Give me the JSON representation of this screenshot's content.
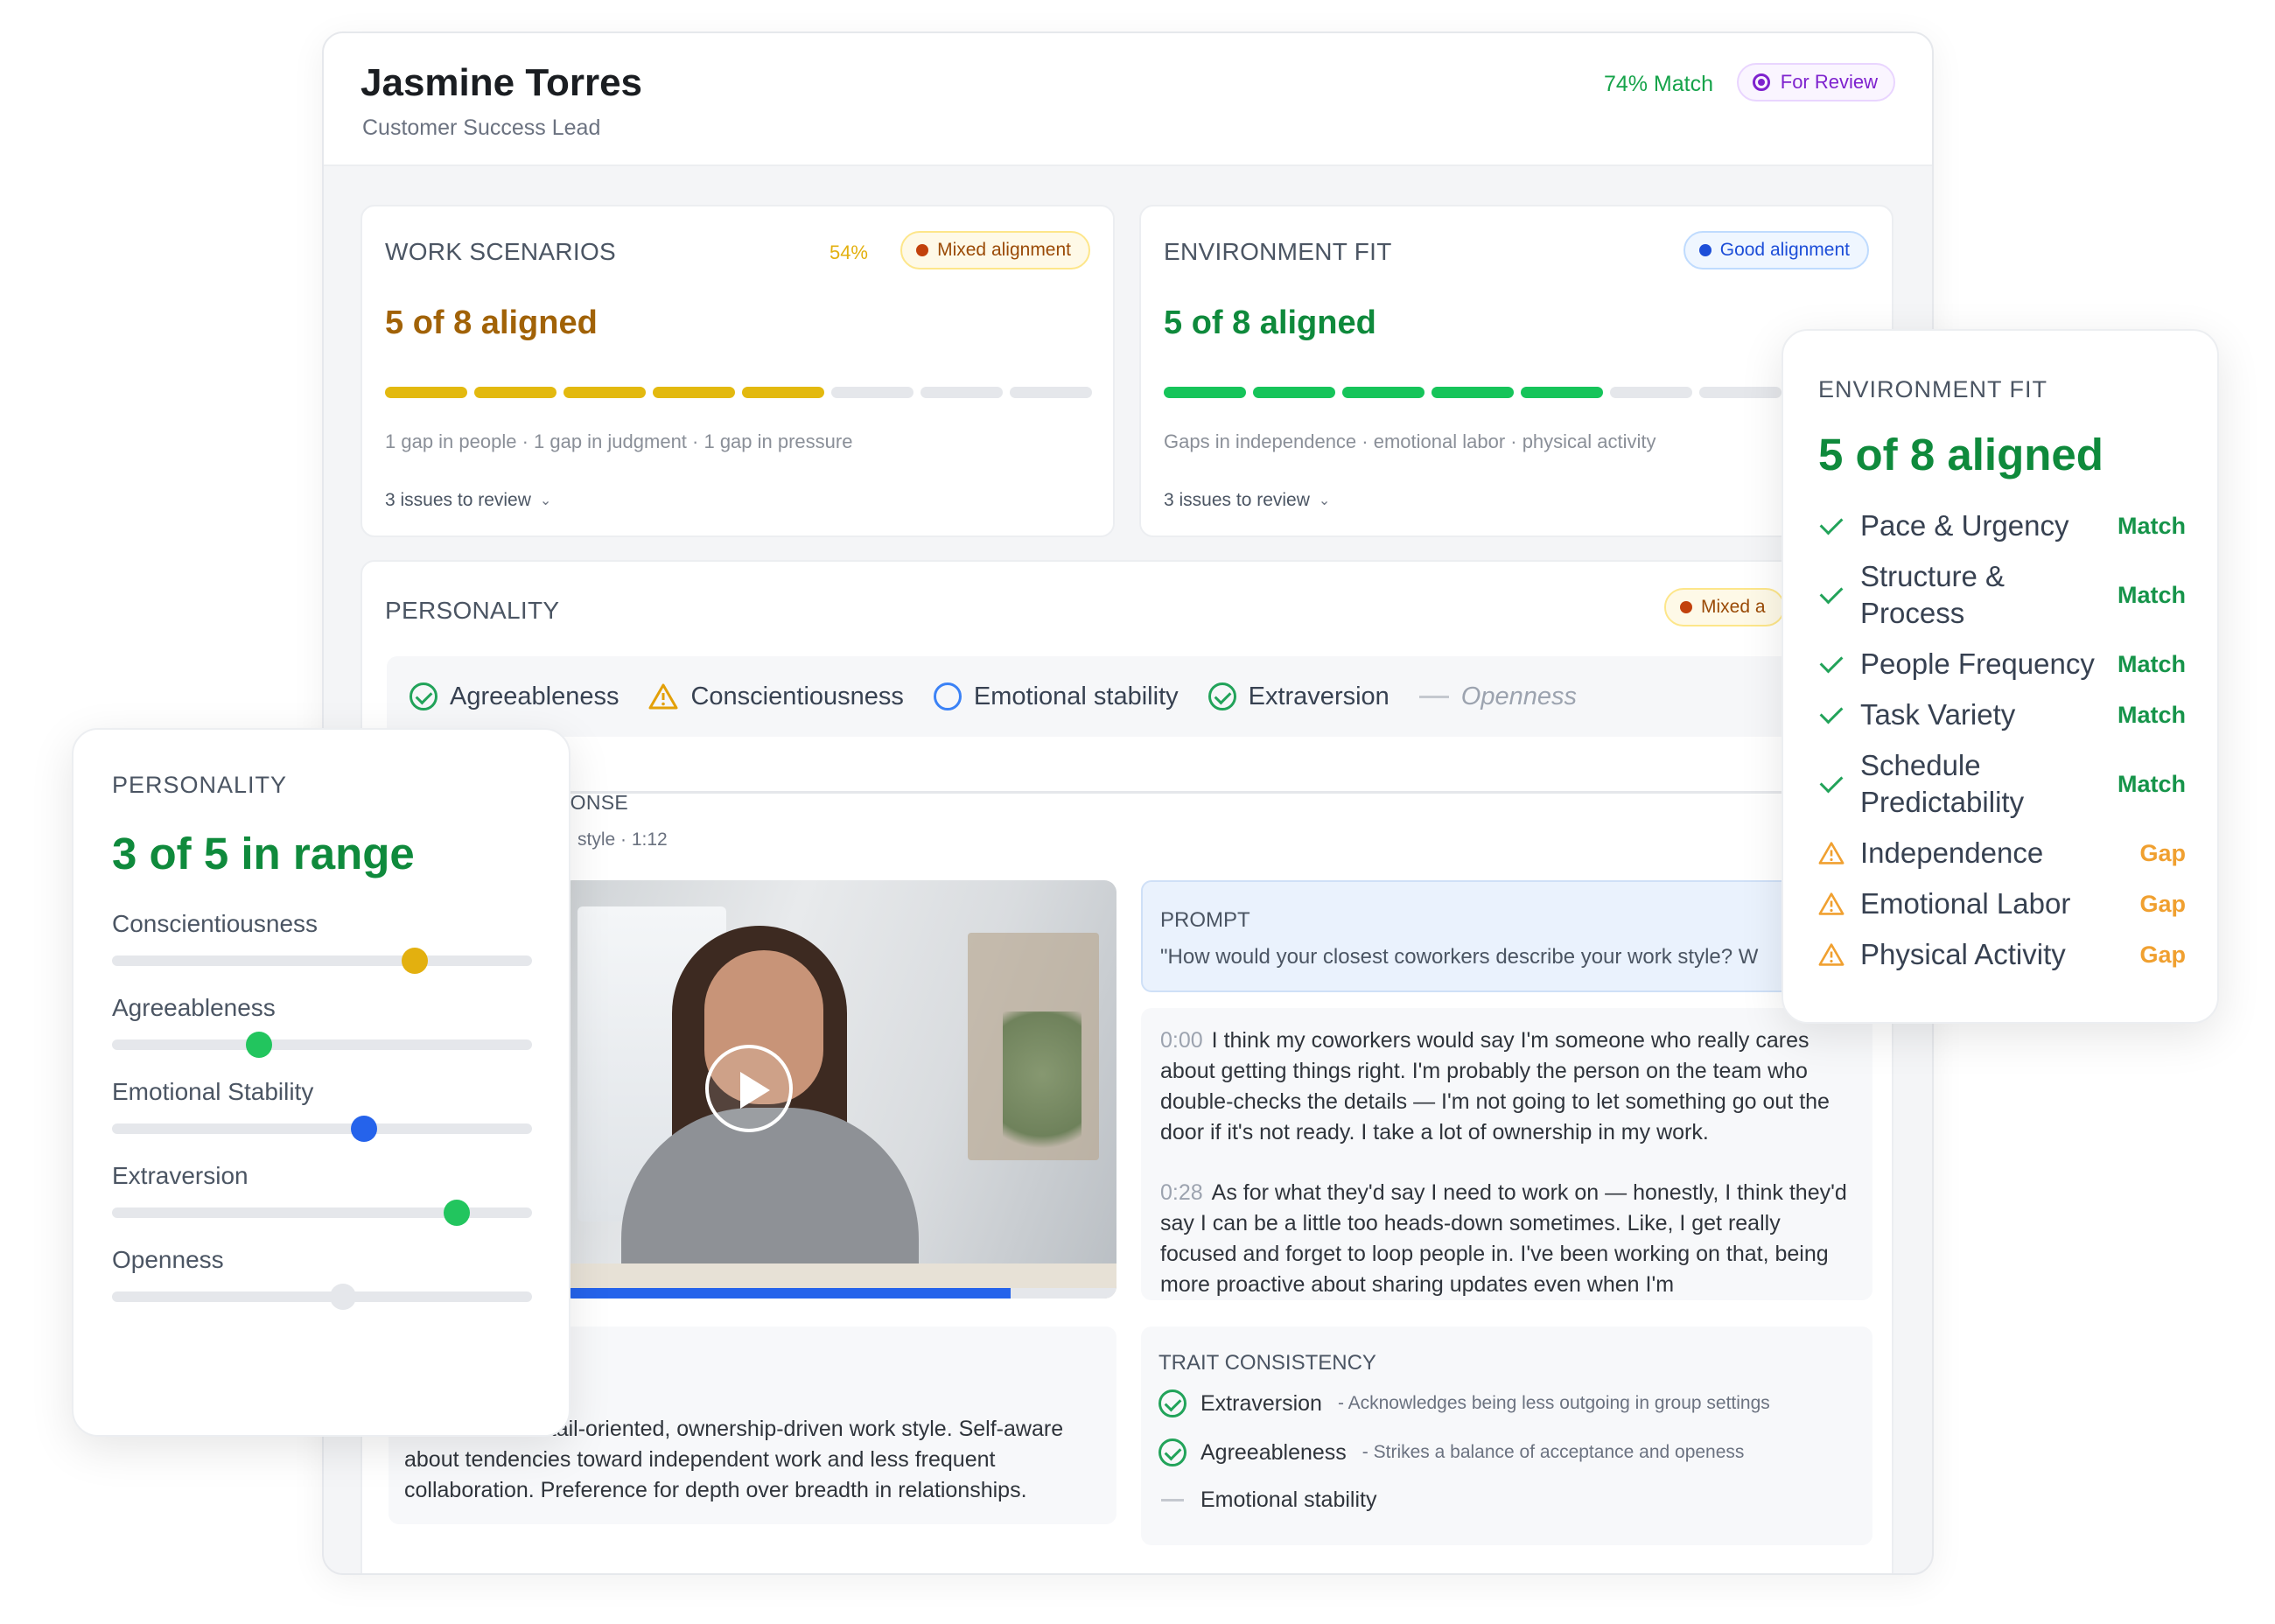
{
  "candidate": {
    "name": "Jasmine Torres",
    "role": "Customer Success Lead",
    "match": "74% Match",
    "status": "For Review"
  },
  "work_scenarios": {
    "title": "WORK SCENARIOS",
    "percent": "54%",
    "badge": "Mixed alignment",
    "count": "5 of 8 aligned",
    "aligned": 5,
    "total": 8,
    "gaps": "1 gap in people · 1 gap in judgment · 1 gap in pressure",
    "issues": "3 issues to review"
  },
  "environment_fit": {
    "title": "ENVIRONMENT FIT",
    "badge": "Good alignment",
    "count": "5 of 8 aligned",
    "aligned": 5,
    "total": 8,
    "gaps": "Gaps in independence · emotional labor · physical activity",
    "issues": "3 issues to review"
  },
  "personality": {
    "title": "PERSONALITY",
    "badge": "Mixed a",
    "traits": [
      {
        "label": "Agreeableness",
        "icon": "check-circle-icon"
      },
      {
        "label": "Conscientiousness",
        "icon": "warning-icon"
      },
      {
        "label": "Emotional stability",
        "icon": "ring-icon"
      },
      {
        "label": "Extraversion",
        "icon": "check-circle-icon"
      },
      {
        "label": "Openness",
        "icon": "dash-icon"
      }
    ]
  },
  "response": {
    "label": "PONSE",
    "meta": "style · 1:12",
    "video_progress": 0.81,
    "prompt_title": "PROMPT",
    "prompt_text": "\"How would your closest coworkers describe your work style? W",
    "transcript": [
      {
        "time": "0:00",
        "text": "I think my coworkers would say I'm someone who really cares about getting things right. I'm probably the person on the team who double-checks the details — I'm not going to let something go out the door if it's not ready. I take a lot of ownership in my work."
      },
      {
        "time": "0:28",
        "text": "As for what they'd say I need to work on — honestly, I think they'd say I can be a little too heads-down sometimes. Like, I get really focused and forget to loop people in. I've been working on that, being more proactive about sharing updates even when I'm"
      }
    ],
    "summary": "Describes a detail-oriented, ownership-driven work style. Self-aware about tendencies toward independent work and less frequent collaboration. Preference for depth over breadth in relationships."
  },
  "trait_consistency": {
    "title": "TRAIT CONSISTENCY",
    "rows": [
      {
        "name": "Extraversion",
        "note": "- Acknowledges being less outgoing in group settings",
        "icon": "check-circle-icon"
      },
      {
        "name": "Agreeableness",
        "note": "- Strikes a balance of acceptance and openess",
        "icon": "check-circle-icon"
      },
      {
        "name": "Emotional stability",
        "note": "",
        "icon": "dash-icon"
      }
    ]
  },
  "personality_card": {
    "title": "PERSONALITY",
    "count": "3 of 5 in range",
    "sliders": [
      {
        "label": "Conscientiousness",
        "value": 0.72,
        "color": "#e3b00f"
      },
      {
        "label": "Agreeableness",
        "value": 0.35,
        "color": "#22c55e"
      },
      {
        "label": "Emotional Stability",
        "value": 0.6,
        "color": "#2563eb"
      },
      {
        "label": "Extraversion",
        "value": 0.82,
        "color": "#22c55e"
      },
      {
        "label": "Openness",
        "value": 0.55,
        "color": "#e5e7eb"
      }
    ]
  },
  "environment_card": {
    "title": "ENVIRONMENT FIT",
    "count": "5 of 8 aligned",
    "rows": [
      {
        "label": "Pace & Urgency",
        "status": "Match"
      },
      {
        "label": "Structure & Process",
        "status": "Match"
      },
      {
        "label": "People Frequency",
        "status": "Match"
      },
      {
        "label": "Task Variety",
        "status": "Match"
      },
      {
        "label": "Schedule Predictability",
        "status": "Match"
      },
      {
        "label": "Independence",
        "status": "Gap"
      },
      {
        "label": "Emotional Labor",
        "status": "Gap"
      },
      {
        "label": "Physical Activity",
        "status": "Gap"
      }
    ]
  },
  "colors": {
    "accent_green": "#16a34a",
    "accent_yellow": "#e3b90f",
    "review_purple": "#7e22ce",
    "progress_blue": "#2563eb"
  }
}
